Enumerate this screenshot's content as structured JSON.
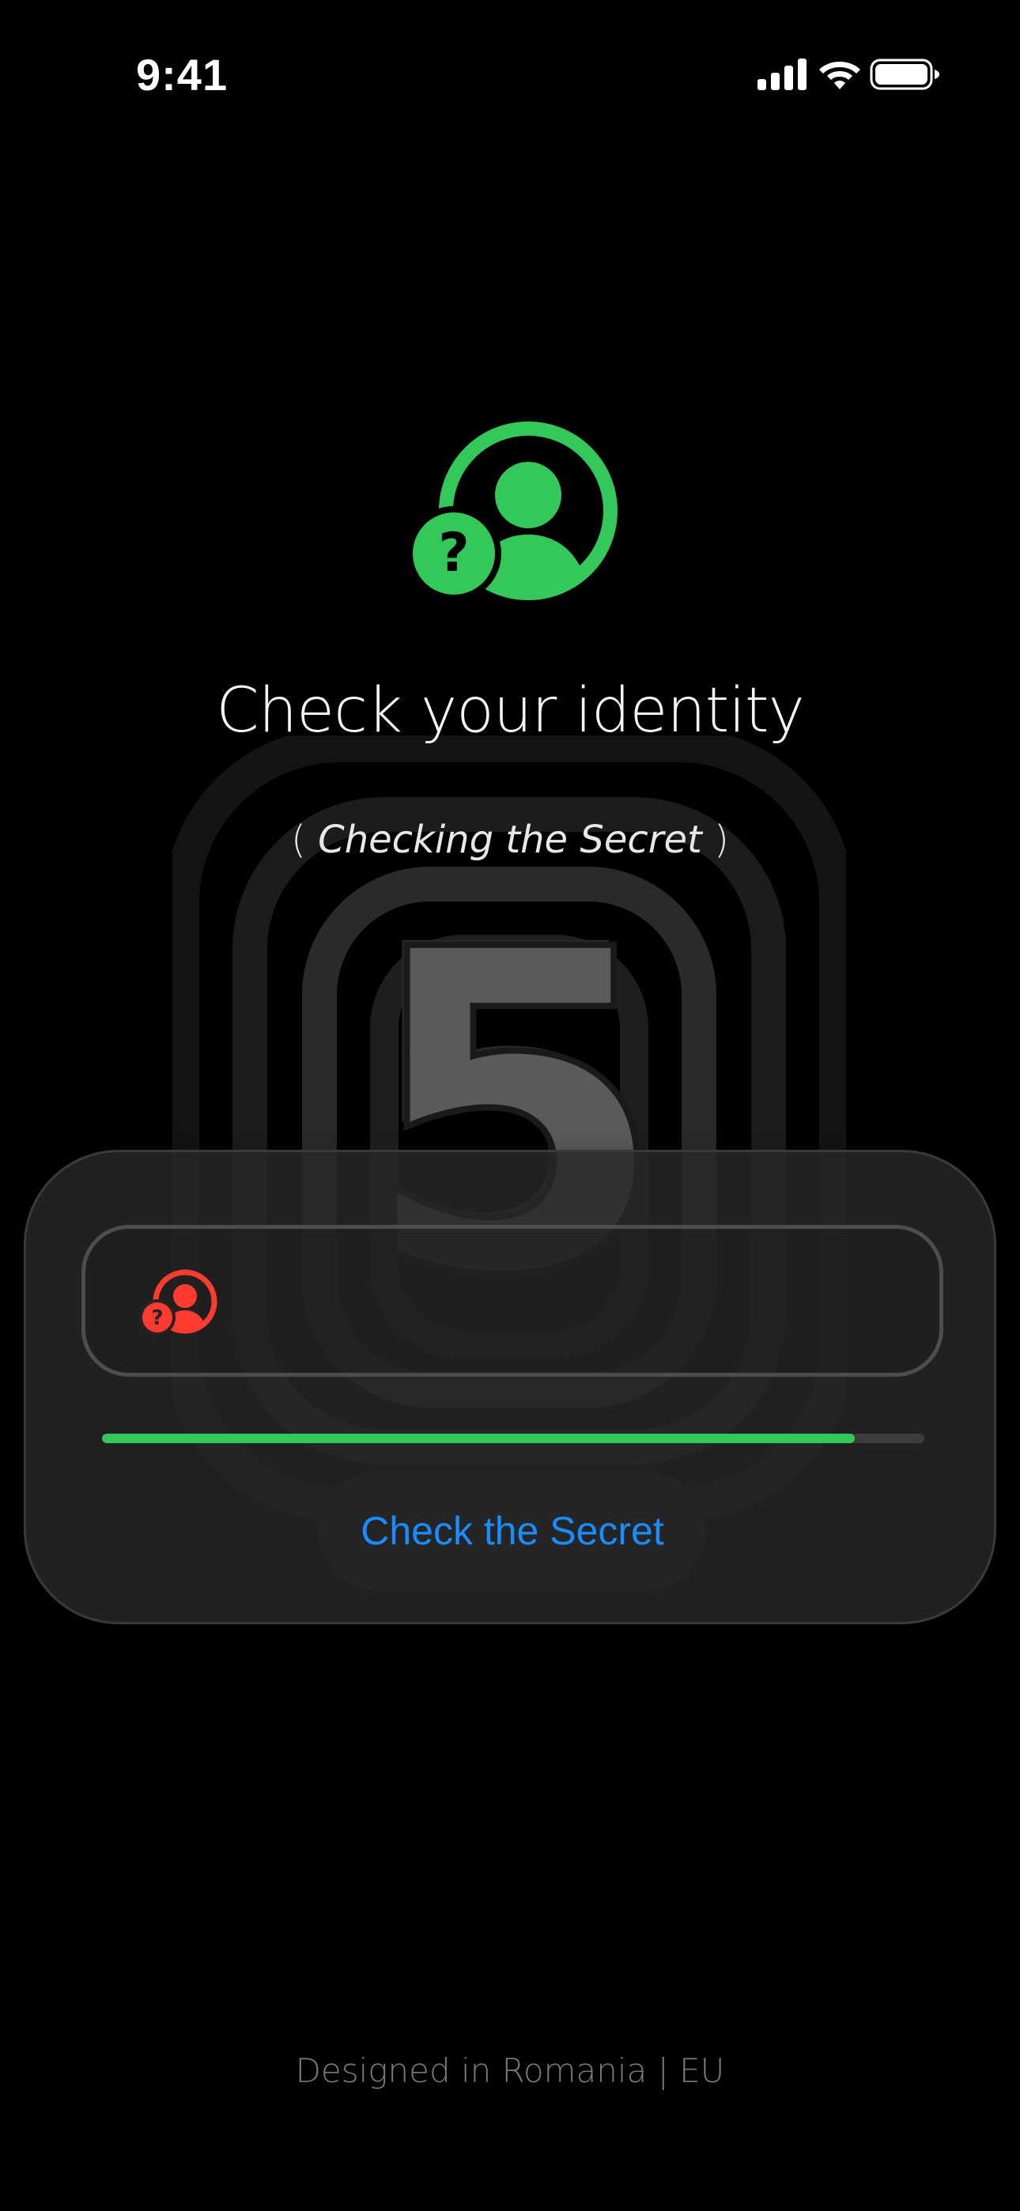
{
  "status_bar": {
    "time": "9:41",
    "icons": [
      "cellular-signal-icon",
      "wifi-icon",
      "battery-icon"
    ]
  },
  "hero": {
    "icon": "person-question-icon",
    "title": "Check your identity",
    "subtitle_open": "(",
    "subtitle_text": "Checking the Secret",
    "subtitle_close": ")",
    "background_digit": "5"
  },
  "card": {
    "input": {
      "icon": "person-question-icon",
      "value": "",
      "placeholder": ""
    },
    "progress": 0.915,
    "button_label": "Check the Secret"
  },
  "footer": {
    "text": "Designed in Romania | EU"
  },
  "colors": {
    "accent_green": "#34c759",
    "alert_red": "#ff3b30",
    "link_blue": "#1a8cff"
  }
}
